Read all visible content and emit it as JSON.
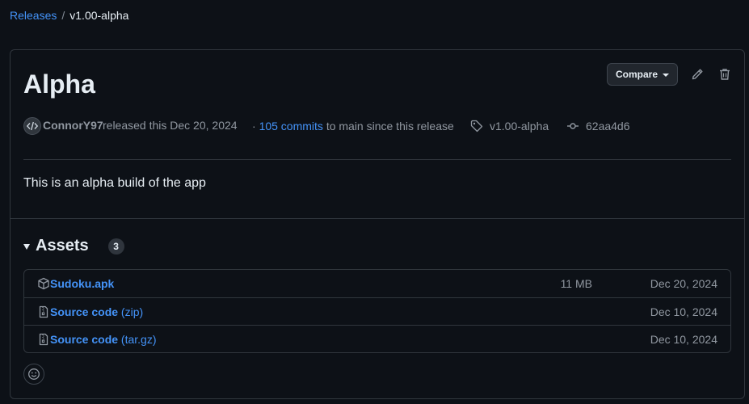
{
  "breadcrumb": {
    "parent": "Releases",
    "separator": "/",
    "current": "v1.00-alpha"
  },
  "release": {
    "title": "Alpha",
    "compare_label": "Compare",
    "author": "ConnorY97",
    "released_text": "released this Dec 20, 2024",
    "commits_prefix": "·",
    "commits_link": "105 commits",
    "commits_suffix": "to main since this release",
    "tag": "v1.00-alpha",
    "commit_sha": "62aa4d6",
    "body": "This is an alpha build of the app"
  },
  "assets": {
    "title": "Assets",
    "count": "3",
    "items": [
      {
        "name": "Sudoku.apk",
        "suffix": "",
        "size": "11 MB",
        "date": "Dec 20, 2024",
        "icon": "package-icon"
      },
      {
        "name": "Source code",
        "suffix": "(zip)",
        "size": "",
        "date": "Dec 10, 2024",
        "icon": "file-zip-icon"
      },
      {
        "name": "Source code",
        "suffix": "(tar.gz)",
        "size": "",
        "date": "Dec 10, 2024",
        "icon": "file-zip-icon"
      }
    ]
  },
  "colors": {
    "background": "#0d1117",
    "border": "#30363d",
    "link": "#4493f8",
    "muted": "#9198a1",
    "text": "#e6edf3"
  }
}
